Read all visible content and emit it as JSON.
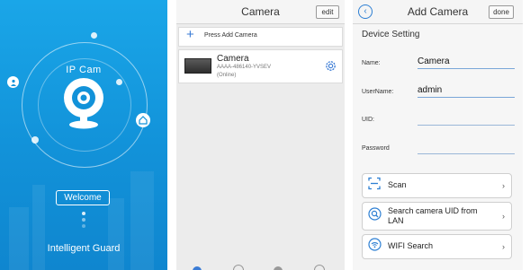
{
  "splash": {
    "app_label": "IP Cam",
    "welcome_button": "Welcome",
    "tagline": "Intelligent Guard"
  },
  "camera_list": {
    "title": "Camera",
    "edit_button": "edit",
    "add_row": "Press Add Camera",
    "cameras": [
      {
        "name": "Camera",
        "uid": "AAAA-486140-YVSEV",
        "status": "(Online)"
      }
    ]
  },
  "add_camera": {
    "title": "Add Camera",
    "done_button": "done",
    "section_title": "Device Setting",
    "fields": [
      {
        "label": "Name:",
        "value": "Camera"
      },
      {
        "label": "UserName:",
        "value": "admin"
      },
      {
        "label": "UID:",
        "value": ""
      },
      {
        "label": "Password",
        "value": ""
      }
    ],
    "actions": [
      {
        "label": "Scan",
        "icon": "scan-icon"
      },
      {
        "label": "Search camera UID from LAN",
        "icon": "search-icon"
      },
      {
        "label": "WIFI Search",
        "icon": "wifi-icon"
      }
    ]
  },
  "colors": {
    "splash_blue": "#1aa6e8",
    "accent_blue": "#2d7fd3",
    "panel_gray": "#ececec"
  }
}
